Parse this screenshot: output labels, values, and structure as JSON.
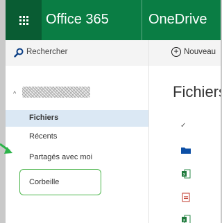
{
  "topbar": {
    "brand": "Office 365",
    "app_name": "OneDrive"
  },
  "sidebar": {
    "search_label": "Rechercher",
    "items": [
      {
        "label": "Fichiers",
        "selected": true
      },
      {
        "label": "Récents",
        "selected": false
      },
      {
        "label": "Partagés avec moi",
        "selected": false
      },
      {
        "label": "Corbeille",
        "selected": false
      }
    ]
  },
  "main": {
    "new_label": "Nouveau",
    "title": "Fichiers"
  },
  "colors": {
    "topbar": "#0a7d44",
    "waffle_bg": "#095c33",
    "selected_item": "#dbe8f4",
    "highlight": "#4bb54b"
  },
  "icons": {
    "folder": "folder-icon",
    "excel": "excel-file-icon",
    "pdf": "pdf-file-icon"
  }
}
